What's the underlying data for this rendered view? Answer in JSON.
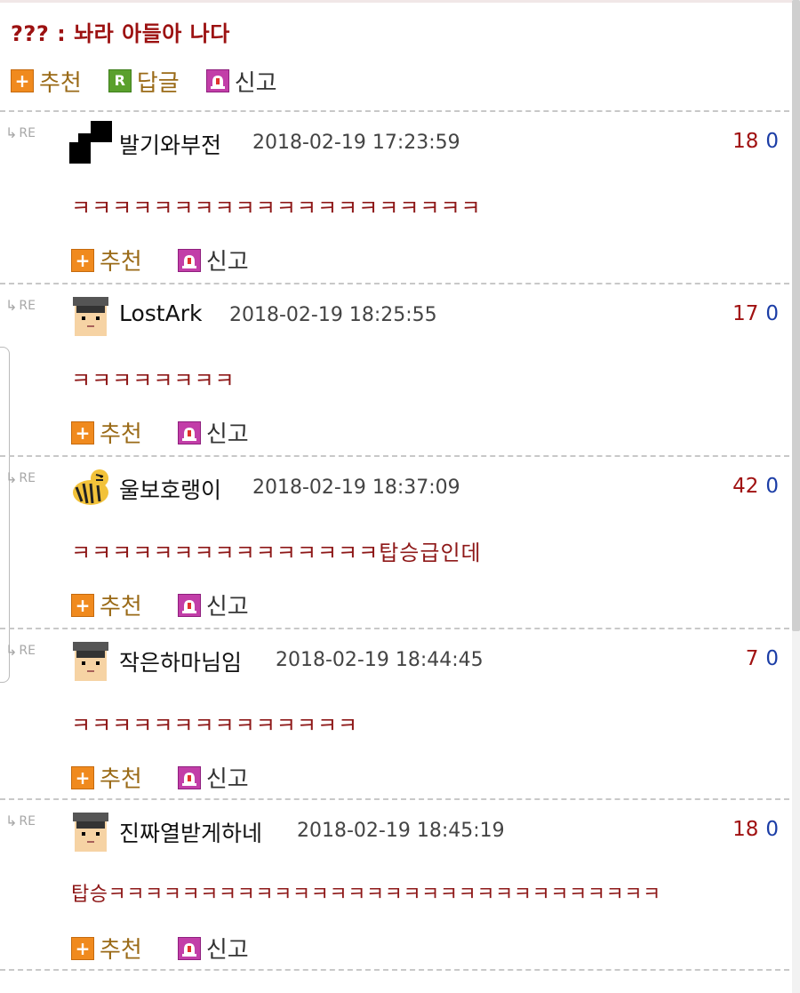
{
  "quote": "??? : 놔라 아들아 나다",
  "actions": {
    "recommend": "추천",
    "reply": "답글",
    "report": "신고",
    "reply_icon": "R"
  },
  "re_label": "RE",
  "comments": [
    {
      "nick": "발기와부전",
      "date": "2018-02-19 17:23:59",
      "rec": "18",
      "rep": "0",
      "text": "ㅋㅋㅋㅋㅋㅋㅋㅋㅋㅋㅋㅋㅋㅋㅋㅋㅋㅋㅋㅋ",
      "avatar": "checker-avatar"
    },
    {
      "nick": "LostArk",
      "date": "2018-02-19 18:25:55",
      "rec": "17",
      "rep": "0",
      "text": "ㅋㅋㅋㅋㅋㅋㅋㅋ",
      "avatar": "graduate-avatar"
    },
    {
      "nick": "울보호랭이",
      "date": "2018-02-19 18:37:09",
      "rec": "42",
      "rep": "0",
      "text": "ㅋㅋㅋㅋㅋㅋㅋㅋㅋㅋㅋㅋㅋㅋㅋ탑승급인데",
      "avatar": "tiger-avatar"
    },
    {
      "nick": "작은하마님임",
      "date": "2018-02-19 18:44:45",
      "rec": "7",
      "rep": "0",
      "text": "ㅋㅋㅋㅋㅋㅋㅋㅋㅋㅋㅋㅋㅋㅋ",
      "avatar": "graduate-avatar"
    },
    {
      "nick": "진짜열받게하네",
      "date": "2018-02-19 18:45:19",
      "rec": "18",
      "rep": "0",
      "text": "탑승ㅋㅋㅋㅋㅋㅋㅋㅋㅋㅋㅋㅋㅋㅋㅋㅋㅋㅋㅋㅋㅋㅋㅋㅋㅋㅋㅋㅋㅋㅋ",
      "avatar": "graduate-avatar"
    }
  ],
  "colors": {
    "quote": "#9c1111",
    "comment_text": "#8e1818",
    "recommend": "#f08a1e",
    "reply": "#5aa02d",
    "report": "#c23ea8"
  }
}
